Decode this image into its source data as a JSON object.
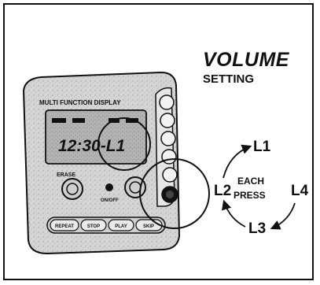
{
  "heading": {
    "title": "VOLUME",
    "subtitle": "SETTING"
  },
  "device": {
    "panel_title": "MULTI FUNCTION DISPLAY",
    "display_text": "12:30-L1",
    "erase_label": "ERASE",
    "on_off_label": "ON/OFF",
    "bottom_buttons": [
      "REPEAT",
      "STOP",
      "PLAY",
      "SKIP"
    ]
  },
  "cycle": {
    "levels": [
      "L1",
      "L2",
      "L3",
      "L4"
    ],
    "center_line1": "EACH",
    "center_line2": "PRESS"
  },
  "colors": {
    "ink": "#111111",
    "device_body": "#d9d9d9",
    "lcd": "#bdbdbd"
  }
}
